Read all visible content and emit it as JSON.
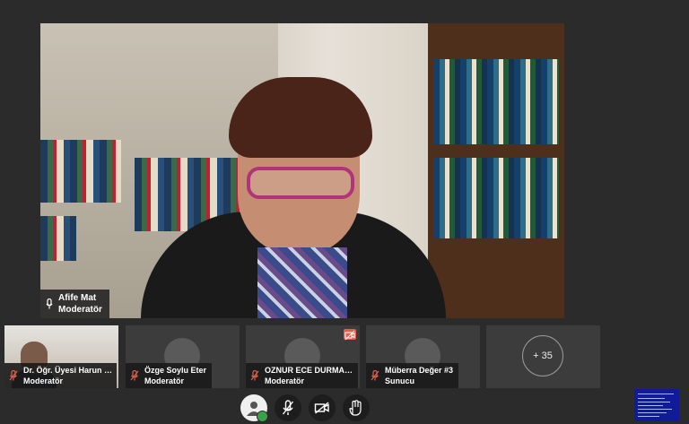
{
  "main_speaker": {
    "name": "Afife Mat",
    "role": "Moderatör"
  },
  "participants": [
    {
      "name": "Dr. Öğr. Üyesi Harun U...",
      "role": "Moderatör",
      "video": true,
      "camera_off_badge": false
    },
    {
      "name": "Özge Soylu Eter",
      "role": "Moderatör",
      "video": false,
      "camera_off_badge": false
    },
    {
      "name": "OZNUR ECE DURMAZ K...",
      "role": "Moderatör",
      "video": false,
      "camera_off_badge": true
    },
    {
      "name": "Müberra Değer #3",
      "role": "Sunucu",
      "video": false,
      "camera_off_badge": false
    }
  ],
  "more_participants": {
    "label": "+ 35"
  },
  "controls": {
    "user_status_icon": "user-avatar-icon",
    "mic_icon": "mic-off-icon",
    "camera_icon": "camera-off-icon",
    "share_icon": "hand-raise-icon"
  },
  "colors": {
    "background": "#2b2b2b",
    "tile": "#3c3c3c",
    "mic_off": "#e0604a",
    "status_ok": "#3aa14a",
    "presentation": "#101a9a"
  }
}
